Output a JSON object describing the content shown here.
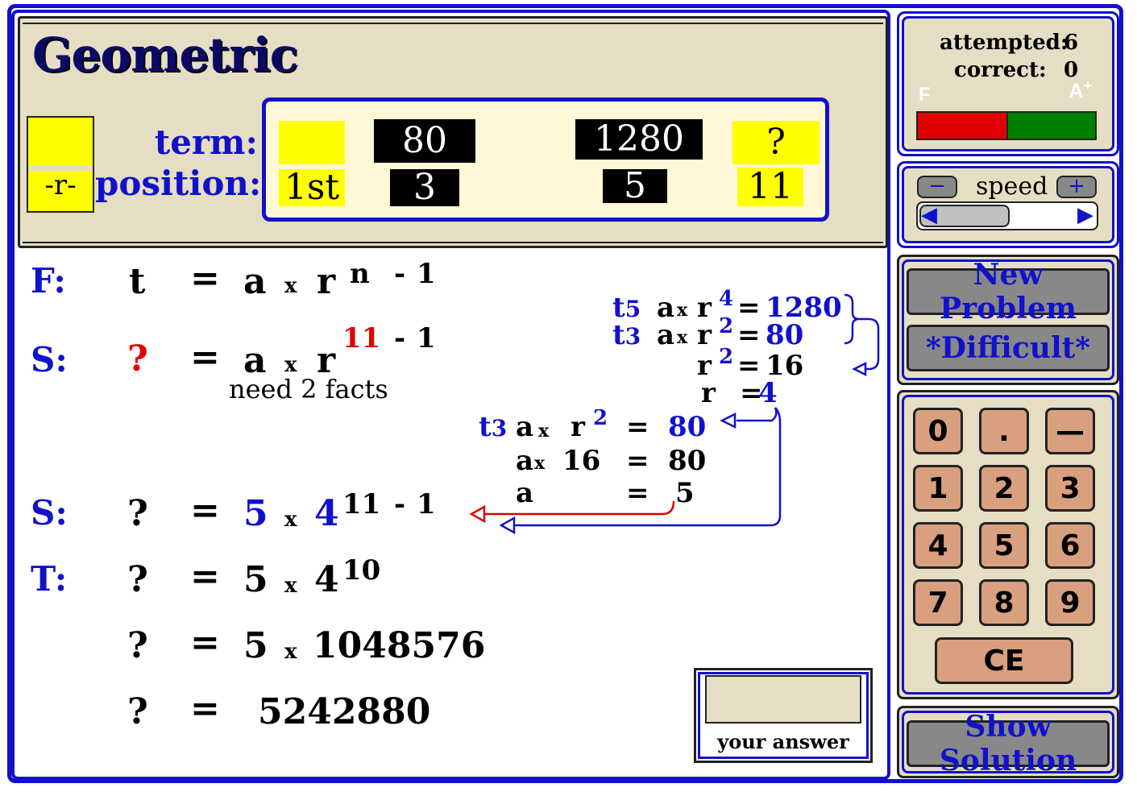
{
  "title": "Geometric",
  "header": {
    "r_label": "-r-",
    "term_label": "term:",
    "position_label": "position:",
    "terms": [
      "",
      "80",
      "1280",
      "?"
    ],
    "positions": [
      "1st",
      "3",
      "5",
      "11"
    ]
  },
  "formula": {
    "F": {
      "label": "F:",
      "lhs": "t",
      "eq": "=",
      "a": "a",
      "x": "x",
      "r": "r",
      "exp_n": "n",
      "exp_minus": "-",
      "exp_one": "1"
    },
    "S1": {
      "label": "S:",
      "lhs": "?",
      "eq": "=",
      "a": "a",
      "x": "x",
      "r": "r",
      "exp_n": "11",
      "exp_minus": "-",
      "exp_one": "1",
      "note": "need 2 facts"
    },
    "S2": {
      "label": "S:",
      "lhs": "?",
      "eq": "=",
      "a": "5",
      "x": "x",
      "r": "4",
      "exp_n": "11",
      "exp_minus": "-",
      "exp_one": "1"
    },
    "T": {
      "label": "T:",
      "lhs": "?",
      "eq": "=",
      "a": "5",
      "x": "x",
      "r": "4",
      "exp": "10"
    },
    "row5": {
      "lhs": "?",
      "eq": "=",
      "a": "5",
      "x": "x",
      "r": "1048576"
    },
    "row6": {
      "lhs": "?",
      "eq": "=",
      "value": "5242880"
    }
  },
  "working": {
    "t5": {
      "t": "t",
      "sub": "5",
      "a": "a",
      "x": "x",
      "r": "r",
      "exp": "4",
      "eq": "=",
      "val": "1280"
    },
    "t3": {
      "t": "t",
      "sub": "3",
      "a": "a",
      "x": "x",
      "r": "r",
      "exp": "2",
      "eq": "=",
      "val": "80"
    },
    "r2": {
      "r": "r",
      "exp": "2",
      "eq": "=",
      "val": "16"
    },
    "r": {
      "r": "r",
      "eq": "=",
      "val": "4"
    },
    "b1": {
      "t": "t",
      "sub": "3",
      "a": "a",
      "x": "x",
      "r": "r",
      "exp": "2",
      "eq": "=",
      "val": "80"
    },
    "b2": {
      "a": "a",
      "x": "x",
      "val16": "16",
      "eq": "=",
      "val": "80"
    },
    "b3": {
      "a": "a",
      "eq": "=",
      "val": "5"
    }
  },
  "answer": {
    "label": "your answer",
    "value": ""
  },
  "stats": {
    "attempted_label": "attempted:",
    "attempted": "6",
    "correct_label": "correct:",
    "correct": "0",
    "grade_low": "F",
    "grade_high": "A",
    "grade_high_sup": "+",
    "bar_red": 0.5
  },
  "speed": {
    "label": "speed",
    "minus": "−",
    "plus": "+",
    "left": "◀",
    "right": "▶"
  },
  "buttons": {
    "new_problem": "New Problem",
    "difficult": "*Difficult*",
    "show_solution": "Show Solution"
  },
  "keypad": [
    "0",
    ".",
    "—",
    "1",
    "2",
    "3",
    "4",
    "5",
    "6",
    "7",
    "8",
    "9",
    "CE"
  ],
  "colors": {
    "accent": "#1111cc",
    "panel": "#e6dec4",
    "yellow": "#ffff00",
    "red": "#e00000",
    "green": "#008000",
    "key": "#d9a07f"
  }
}
